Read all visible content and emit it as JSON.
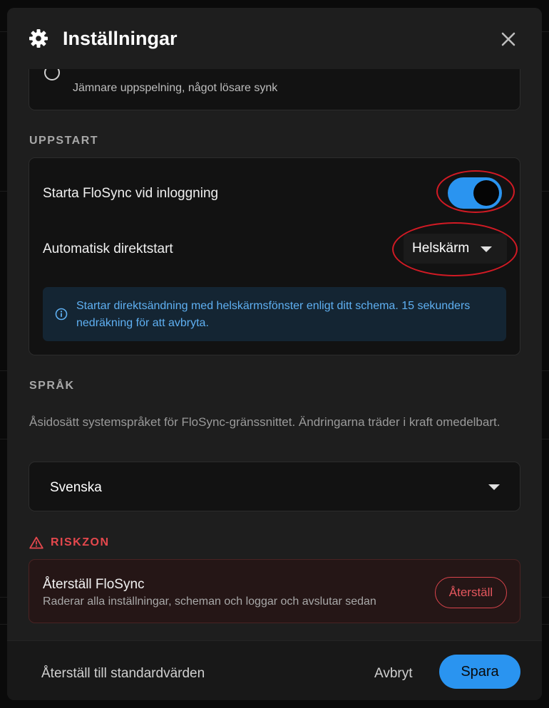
{
  "dialog": {
    "title": "Inställningar",
    "icon": "gear-icon",
    "close_icon": "close-icon"
  },
  "playback": {
    "option_description": "Jämnare uppspelning, något lösare synk"
  },
  "startup": {
    "section_label": "UPPSTART",
    "launch_on_login_label": "Starta FloSync vid inloggning",
    "launch_on_login_enabled": true,
    "auto_live_label": "Automatisk direktstart",
    "auto_live_value": "Helskärm",
    "info_text": "Startar direktsändning med helskärmsfönster enligt ditt schema. 15 sekunders nedräkning för att avbryta."
  },
  "language": {
    "section_label": "SPRÅK",
    "description": "Åsidosätt systemspråket för FloSync-gränssnittet. Ändringarna träder i kraft omedelbart.",
    "selected": "Svenska"
  },
  "danger": {
    "section_label": "RISKZON",
    "reset_title": "Återställ FloSync",
    "reset_description": "Raderar alla inställningar, scheman och loggar och avslutar sedan",
    "reset_button": "Återställ"
  },
  "footer": {
    "restore_defaults": "Återställ till standardvärden",
    "cancel": "Avbryt",
    "save": "Spara"
  },
  "colors": {
    "accent": "#2a94f0",
    "danger": "#e5484d",
    "annotation": "#d21a24",
    "info_text": "#5fb0f2"
  }
}
